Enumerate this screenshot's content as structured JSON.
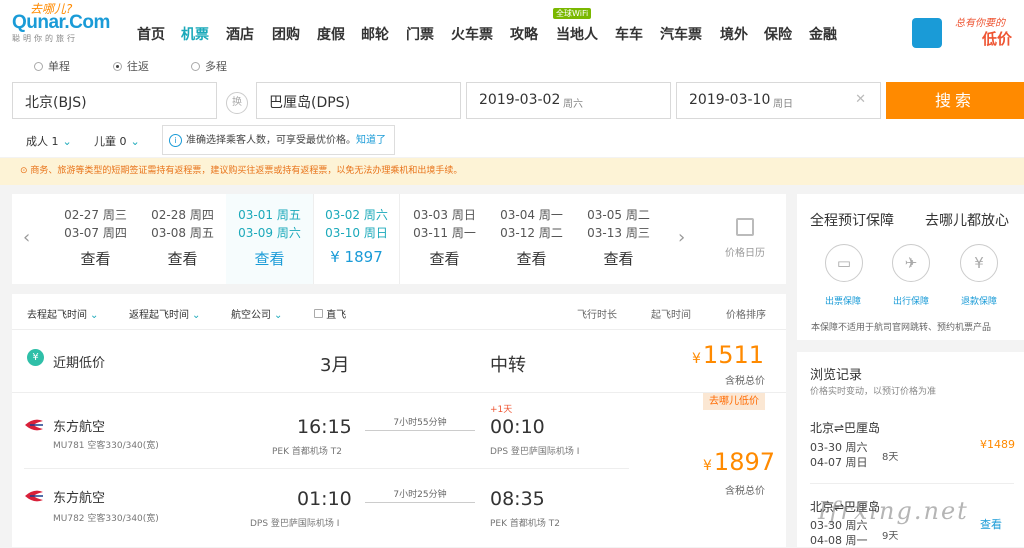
{
  "header": {
    "logo_cn": "去哪儿?",
    "logo_en": "Qunar.Com",
    "logo_sub": "聪明你的旅行",
    "nav": [
      "首页",
      "机票",
      "酒店",
      "团购",
      "度假",
      "邮轮",
      "门票",
      "火车票",
      "攻略",
      "当地人",
      "车车",
      "汽车票",
      "境外",
      "保险",
      "金融"
    ],
    "nav_active": "机票",
    "wifi_badge": "全球WiFi",
    "ad_line1": "总有你要的",
    "ad_line2": "低价"
  },
  "search": {
    "trip_types": [
      "单程",
      "往返",
      "多程"
    ],
    "trip_selected": "往返",
    "from": "北京(BJS)",
    "swap_label": "换",
    "to": "巴厘岛(DPS)",
    "depart_date": "2019-03-02",
    "depart_weekday": "周六",
    "return_date": "2019-03-10",
    "return_weekday": "周日",
    "search_button": "搜索",
    "adults": "成人 1",
    "children": "儿童 0",
    "tip_text": "准确选择乘客人数，可享受最优价格。",
    "tip_link": "知道了"
  },
  "notice": "商务、旅游等类型的短期签证需持有返程票，建议购买往返票或持有返程票，以免无法办理乘机和出境手续。",
  "date_strip": {
    "items": [
      {
        "d1": "02-27 周三",
        "d2": "03-07 周四",
        "price": "查看"
      },
      {
        "d1": "02-28 周四",
        "d2": "03-08 周五",
        "price": "查看"
      },
      {
        "d1": "03-01 周五",
        "d2": "03-09 周六",
        "price": "查看"
      },
      {
        "d1": "03-02 周六",
        "d2": "03-10 周日",
        "price": "¥ 1897"
      },
      {
        "d1": "03-03 周日",
        "d2": "03-11 周一",
        "price": "查看"
      },
      {
        "d1": "03-04 周一",
        "d2": "03-12 周二",
        "price": "查看"
      },
      {
        "d1": "03-05 周二",
        "d2": "03-13 周三",
        "price": "查看"
      }
    ],
    "calendar_label": "价格日历"
  },
  "filters": {
    "out_time": "去程起飞时间",
    "ret_time": "返程起飞时间",
    "airline": "航空公司",
    "direct": "直飞",
    "sort_duration": "飞行时长",
    "sort_depart": "起飞时间",
    "sort_price": "价格排序"
  },
  "lowest": {
    "label": "近期低价",
    "month": "3月",
    "type": "中转",
    "currency": "¥",
    "price": "1511",
    "tax_note": "含税总价"
  },
  "flight": {
    "badge": "去哪儿低价",
    "currency": "¥",
    "price": "1897",
    "tax_note": "含税总价",
    "legs": [
      {
        "airline": "东方航空",
        "flight": "MU781 空客330/340(宽)",
        "dep_time": "16:15",
        "dep_airport": "PEK 首都机场 T2",
        "duration": "7小时55分钟",
        "arr_time": "00:10",
        "arr_airport": "DPS 登巴萨国际机场 I",
        "day_offset": "+1天"
      },
      {
        "airline": "东方航空",
        "flight": "MU782 空客330/340(宽)",
        "dep_time": "01:10",
        "dep_airport": "DPS 登巴萨国际机场 I",
        "duration": "7小时25分钟",
        "arr_time": "08:35",
        "arr_airport": "PEK 首都机场 T2",
        "day_offset": ""
      }
    ]
  },
  "guarantee": {
    "title": "全程预订保障",
    "slogan": "去哪儿都放心",
    "items": [
      "出票保障",
      "出行保障",
      "退款保障"
    ],
    "note": "本保障不适用于航司官网跳转、预约机票产品"
  },
  "history": {
    "title": "浏览记录",
    "subtitle": "价格实时变动，以预订价格为准",
    "items": [
      {
        "route": "北京⇌巴厘岛",
        "d1": "03-30 周六",
        "d2": "04-07 周日",
        "days": "8天",
        "price": "¥1489"
      },
      {
        "route": "北京⇌巴厘岛",
        "d1": "03-30 周六",
        "d2": "04-08 周一",
        "days": "9天",
        "price": "查看"
      }
    ]
  },
  "watermark": "Ifrxing.net",
  "colors": {
    "accent": "#1ba9ba",
    "orange": "#ff8a00",
    "link": "#1a9bd7"
  }
}
